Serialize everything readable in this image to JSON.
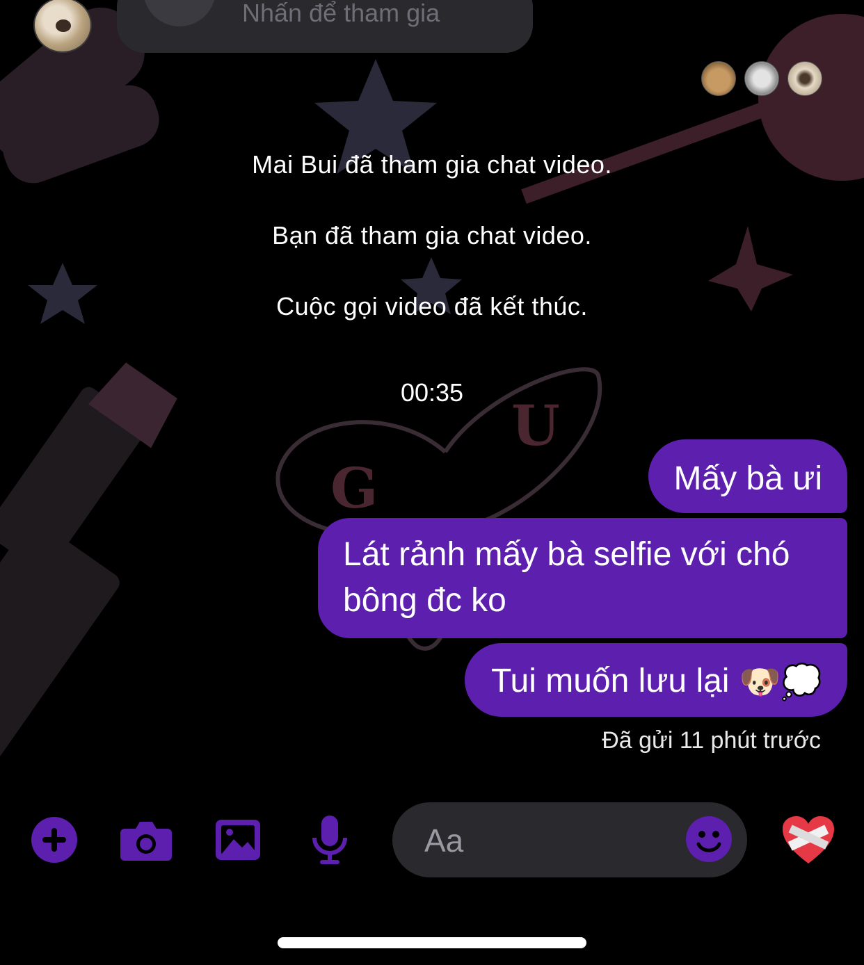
{
  "header": {
    "join_label": "Nhấn để tham gia"
  },
  "seen_by": [
    {
      "name": "avatar-seen-1"
    },
    {
      "name": "avatar-seen-2"
    },
    {
      "name": "avatar-seen-3"
    }
  ],
  "system_messages": [
    "Mai Bui đã tham gia chat video.",
    "Bạn đã tham gia chat video.",
    "Cuộc gọi video đã kết thúc."
  ],
  "call_duration": "00:35",
  "messages": [
    {
      "text": "Mấy bà ưi"
    },
    {
      "text_line1": "Lát rảnh mấy bà selfie với chó",
      "text_line2": "bông đc ko"
    },
    {
      "text": "Tui muốn lưu lại",
      "emojis": "🐶💭"
    }
  ],
  "sent_status": "Đã gửi 11 phút trước",
  "composer": {
    "placeholder": "Aa",
    "icons": [
      "plus-icon",
      "camera-icon",
      "image-icon",
      "microphone-icon",
      "emoji-icon",
      "heart-icon"
    ]
  },
  "colors": {
    "accent": "#5c1fae",
    "background": "#000000",
    "input_bg": "#2a292e"
  }
}
